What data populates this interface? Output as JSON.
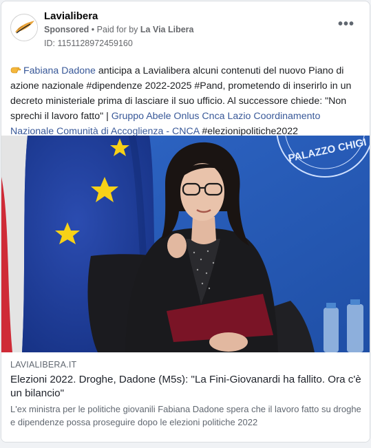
{
  "ad": {
    "page_name": "Lavialibera",
    "sponsored_label": "Sponsored",
    "paid_for_prefix": "Paid for by",
    "payer": "La Via Libera",
    "separator": "•",
    "ad_id": "ID: 1151128972459160",
    "more_icon": "more-options-icon"
  },
  "post": {
    "hand_icon": "hand-pointing-icon",
    "mention_person": "Fabiana Dadone",
    "text_1": " anticipa a Lavialibera alcuni contenuti del nuovo Piano di azione nazionale #dipendenze 2022-2025 #Pand, prometendo di inserirlo in un decreto ministeriale prima di lasciare il suo ufficio. Al successore chiede: \"Non sprechi il lavoro fatto\" | ",
    "mention_orgs": "Gruppo Abele Onlus Cnca Lazio Coordinamento Nazionale Comunità di Accoglienza - CNCA",
    "text_2": " #elezionipolitiche2022"
  },
  "photo": {
    "seal_text": "PALAZZO CHIGI"
  },
  "link_preview": {
    "domain": "LAVIALIBERA.IT",
    "title": "Elezioni 2022. Droghe, Dadone (M5s): \"La Fini-Giovanardi ha fallito. Ora c'è un bilancio\"",
    "description": "L'ex ministra per le politiche giovanili Fabiana Dadone spera che il lavoro fatto su droghe e dipendenze possa proseguire dopo le elezioni politiche 2022"
  },
  "colors": {
    "link": "#385898",
    "brand_gold": "#e8a33a",
    "eu_blue": "#1f3f98",
    "eu_star": "#f7d117"
  }
}
